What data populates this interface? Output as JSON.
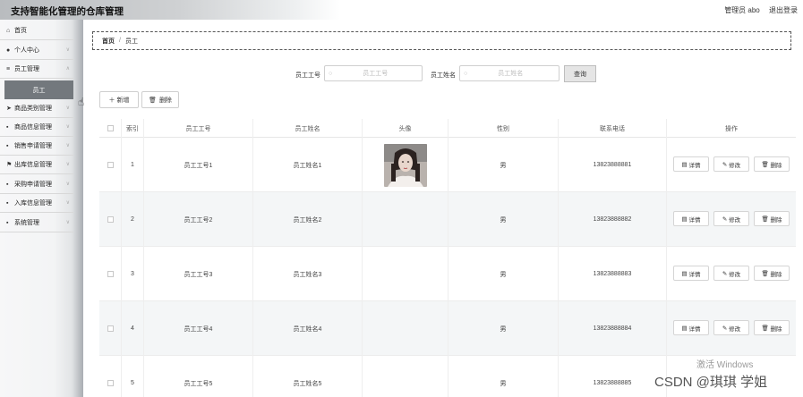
{
  "header": {
    "title": "支持智能化管理的仓库管理",
    "user_label": "管理员 abo",
    "logout_label": "退出登录"
  },
  "sidebar": {
    "items": [
      {
        "label": "首页",
        "icon": "home-icon"
      },
      {
        "label": "个人中心",
        "icon": "user-icon"
      },
      {
        "label": "员工管理",
        "icon": "list-icon"
      },
      {
        "label": "商品类别管理",
        "icon": "send-icon"
      },
      {
        "label": "商品信息管理",
        "icon": "grid-icon"
      },
      {
        "label": "销售申请管理",
        "icon": "grid-icon"
      },
      {
        "label": "出库信息管理",
        "icon": "flag-icon"
      },
      {
        "label": "采购申请管理",
        "icon": "grid-icon"
      },
      {
        "label": "入库信息管理",
        "icon": "grid-icon"
      },
      {
        "label": "系统管理",
        "icon": "grid-icon"
      }
    ],
    "active_sub": "员工"
  },
  "breadcrumb": {
    "home": "首页",
    "separator": "/",
    "current": "员工"
  },
  "search": {
    "emp_no_label": "员工工号",
    "emp_no_placeholder": "员工工号",
    "emp_name_label": "员工姓名",
    "emp_name_placeholder": "员工姓名",
    "query_label": "查询"
  },
  "actions": {
    "add_label": "＋ 新增",
    "delete_label": "删除"
  },
  "table": {
    "columns": [
      "索引",
      "员工工号",
      "员工姓名",
      "头像",
      "性别",
      "联系电话",
      "操作"
    ],
    "rows": [
      {
        "index": "1",
        "emp_no": "员工工号1",
        "emp_name": "员工姓名1",
        "gender": "男",
        "phone": "13823888881"
      },
      {
        "index": "2",
        "emp_no": "员工工号2",
        "emp_name": "员工姓名2",
        "gender": "男",
        "phone": "13823888882"
      },
      {
        "index": "3",
        "emp_no": "员工工号3",
        "emp_name": "员工姓名3",
        "gender": "男",
        "phone": "13823888883"
      },
      {
        "index": "4",
        "emp_no": "员工工号4",
        "emp_name": "员工姓名4",
        "gender": "男",
        "phone": "13823888884"
      },
      {
        "index": "5",
        "emp_no": "员工工号5",
        "emp_name": "员工姓名5",
        "gender": "男",
        "phone": "13823888885"
      }
    ],
    "op_detail": "详情",
    "op_edit": "修改",
    "op_delete": "删除"
  },
  "overlay": {
    "activate_windows": "激活 Windows",
    "csdn": "CSDN @琪琪 学姐"
  }
}
